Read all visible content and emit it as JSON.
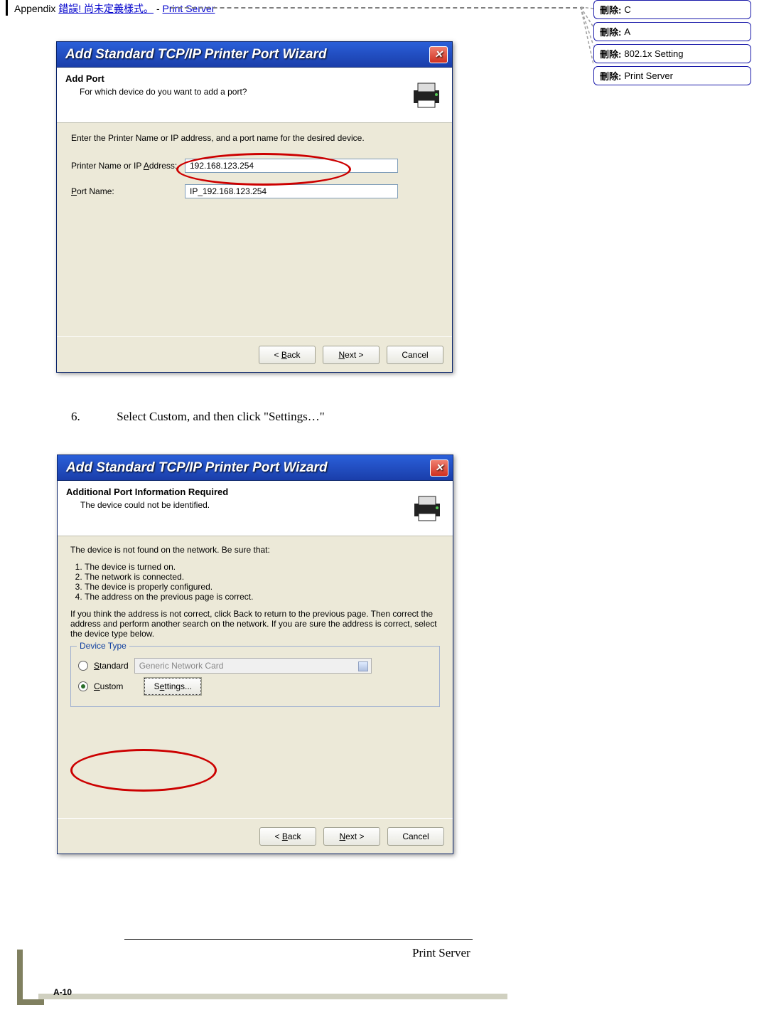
{
  "header": {
    "prefix": "Appendix ",
    "error_text": "錯誤! 尚未定義樣式。",
    "sep": " - ",
    "link": "Print Server"
  },
  "comments": [
    {
      "label": "刪除:",
      "value": "C"
    },
    {
      "label": "刪除:",
      "value": "A"
    },
    {
      "label": "刪除:",
      "value": "802.1x Setting"
    },
    {
      "label": "刪除:",
      "value": "Print Server"
    }
  ],
  "dialog1": {
    "title": "Add Standard TCP/IP Printer Port Wizard",
    "header_title": "Add Port",
    "header_sub": "For which device do you want to add a port?",
    "intro": "Enter the Printer Name or IP address, and a port name for the desired device.",
    "label_addr": "Printer Name or IP Address:",
    "value_addr": "192.168.123.254",
    "label_port": "Port Name:",
    "value_port": "IP_192.168.123.254",
    "btn_back": "< Back",
    "btn_next": "Next >",
    "btn_cancel": "Cancel"
  },
  "step": {
    "num": "6.",
    "text": "Select Custom, and then click \"Settings…\""
  },
  "dialog2": {
    "title": "Add Standard TCP/IP Printer Port Wizard",
    "header_title": "Additional Port Information Required",
    "header_sub": "The device could not be identified.",
    "intro": "The device is not found on the network. Be sure that:",
    "list": [
      "The device is turned on.",
      "The network is connected.",
      "The device is properly configured.",
      "The address on the previous page is correct."
    ],
    "para": "If you think the address is not correct, click Back to return to the previous page. Then correct the address and perform another search on the network. If you are sure the address is correct, select the device type below.",
    "fieldset_legend": "Device Type",
    "radio_standard": "Standard",
    "combo_value": "Generic Network Card",
    "radio_custom": "Custom",
    "btn_settings": "Settings...",
    "btn_back": "< Back",
    "btn_next": "Next >",
    "btn_cancel": "Cancel"
  },
  "footer": {
    "text": "Print Server",
    "page": "A-10"
  }
}
